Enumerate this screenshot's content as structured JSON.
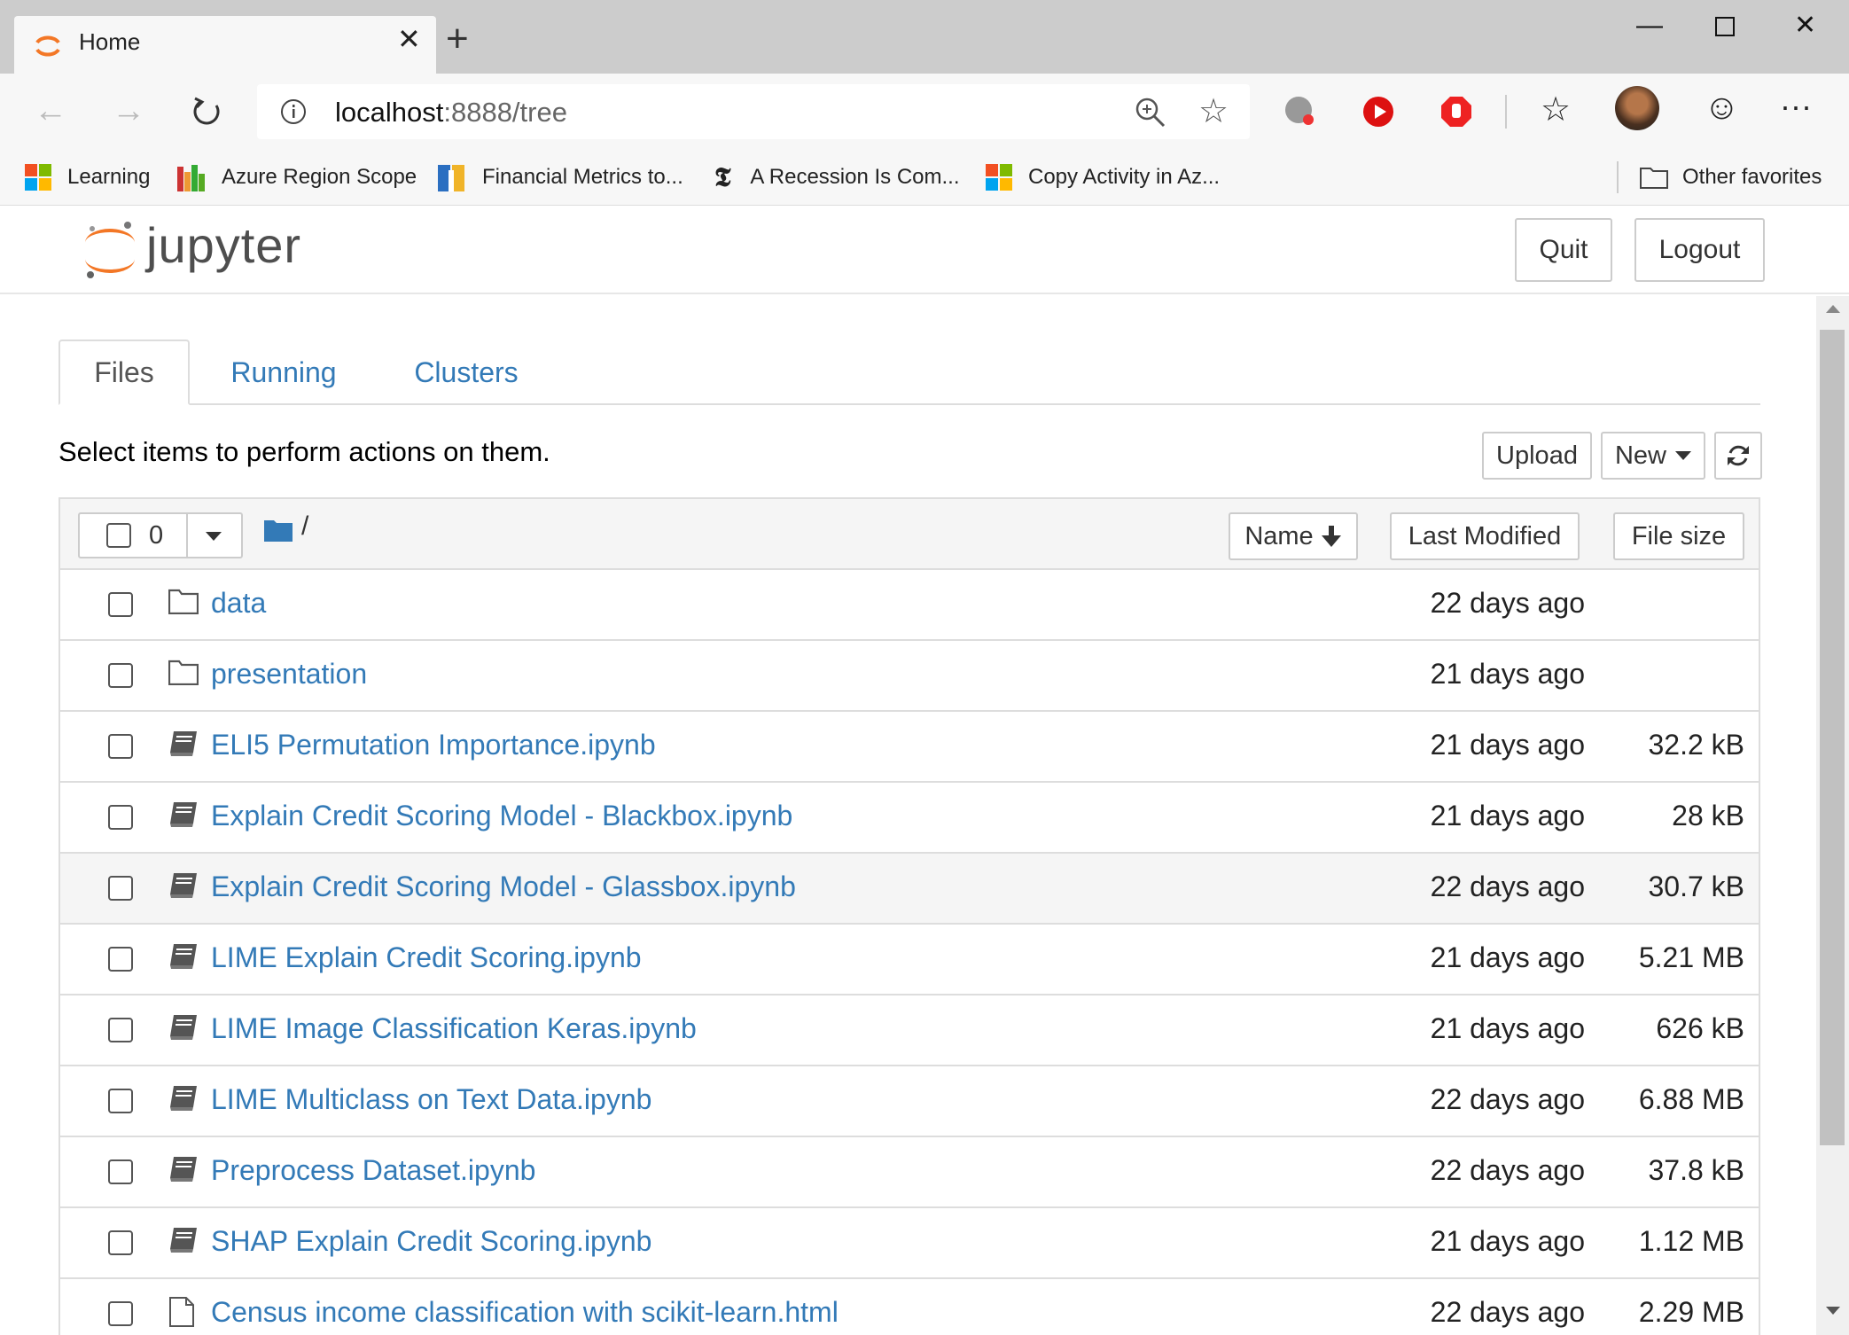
{
  "browser": {
    "tab_title": "Home",
    "url_host": "localhost",
    "url_port_path": ":8888/tree",
    "bookmarks": [
      {
        "label": "Learning",
        "icon": "microsoft-icon"
      },
      {
        "label": "Azure Region Scope",
        "icon": "bar-chart-icon"
      },
      {
        "label": "Financial Metrics to...",
        "icon": "tableau-icon"
      },
      {
        "label": "A Recession Is Com...",
        "icon": "nytimes-icon"
      },
      {
        "label": "Copy Activity in Az...",
        "icon": "microsoft-icon"
      }
    ],
    "other_favorites": "Other favorites"
  },
  "header": {
    "logo_text": "jupyter",
    "quit_label": "Quit",
    "logout_label": "Logout"
  },
  "tabs": [
    {
      "label": "Files",
      "active": true
    },
    {
      "label": "Running",
      "active": false
    },
    {
      "label": "Clusters",
      "active": false
    }
  ],
  "toolbar": {
    "message": "Select items to perform actions on them.",
    "upload_label": "Upload",
    "new_label": "New"
  },
  "list_header": {
    "selected_count": "0",
    "breadcrumb": "/",
    "sort_name": "Name",
    "sort_modified": "Last Modified",
    "sort_size": "File size"
  },
  "files": [
    {
      "name": "data",
      "type": "folder",
      "modified": "22 days ago",
      "size": ""
    },
    {
      "name": "presentation",
      "type": "folder",
      "modified": "21 days ago",
      "size": ""
    },
    {
      "name": "ELI5 Permutation Importance.ipynb",
      "type": "notebook",
      "modified": "21 days ago",
      "size": "32.2 kB"
    },
    {
      "name": "Explain Credit Scoring Model - Blackbox.ipynb",
      "type": "notebook",
      "modified": "21 days ago",
      "size": "28 kB"
    },
    {
      "name": "Explain Credit Scoring Model - Glassbox.ipynb",
      "type": "notebook",
      "modified": "22 days ago",
      "size": "30.7 kB"
    },
    {
      "name": "LIME Explain Credit Scoring.ipynb",
      "type": "notebook",
      "modified": "21 days ago",
      "size": "5.21 MB"
    },
    {
      "name": "LIME Image Classification Keras.ipynb",
      "type": "notebook",
      "modified": "21 days ago",
      "size": "626 kB"
    },
    {
      "name": "LIME Multiclass on Text Data.ipynb",
      "type": "notebook",
      "modified": "22 days ago",
      "size": "6.88 MB"
    },
    {
      "name": "Preprocess Dataset.ipynb",
      "type": "notebook",
      "modified": "22 days ago",
      "size": "37.8 kB"
    },
    {
      "name": "SHAP Explain Credit Scoring.ipynb",
      "type": "notebook",
      "modified": "21 days ago",
      "size": "1.12 MB"
    },
    {
      "name": "Census income classification with scikit-learn.html",
      "type": "file",
      "modified": "22 days ago",
      "size": "2.29 MB"
    }
  ],
  "colors": {
    "link": "#337ab7",
    "jupyter_orange": "#f37726"
  }
}
